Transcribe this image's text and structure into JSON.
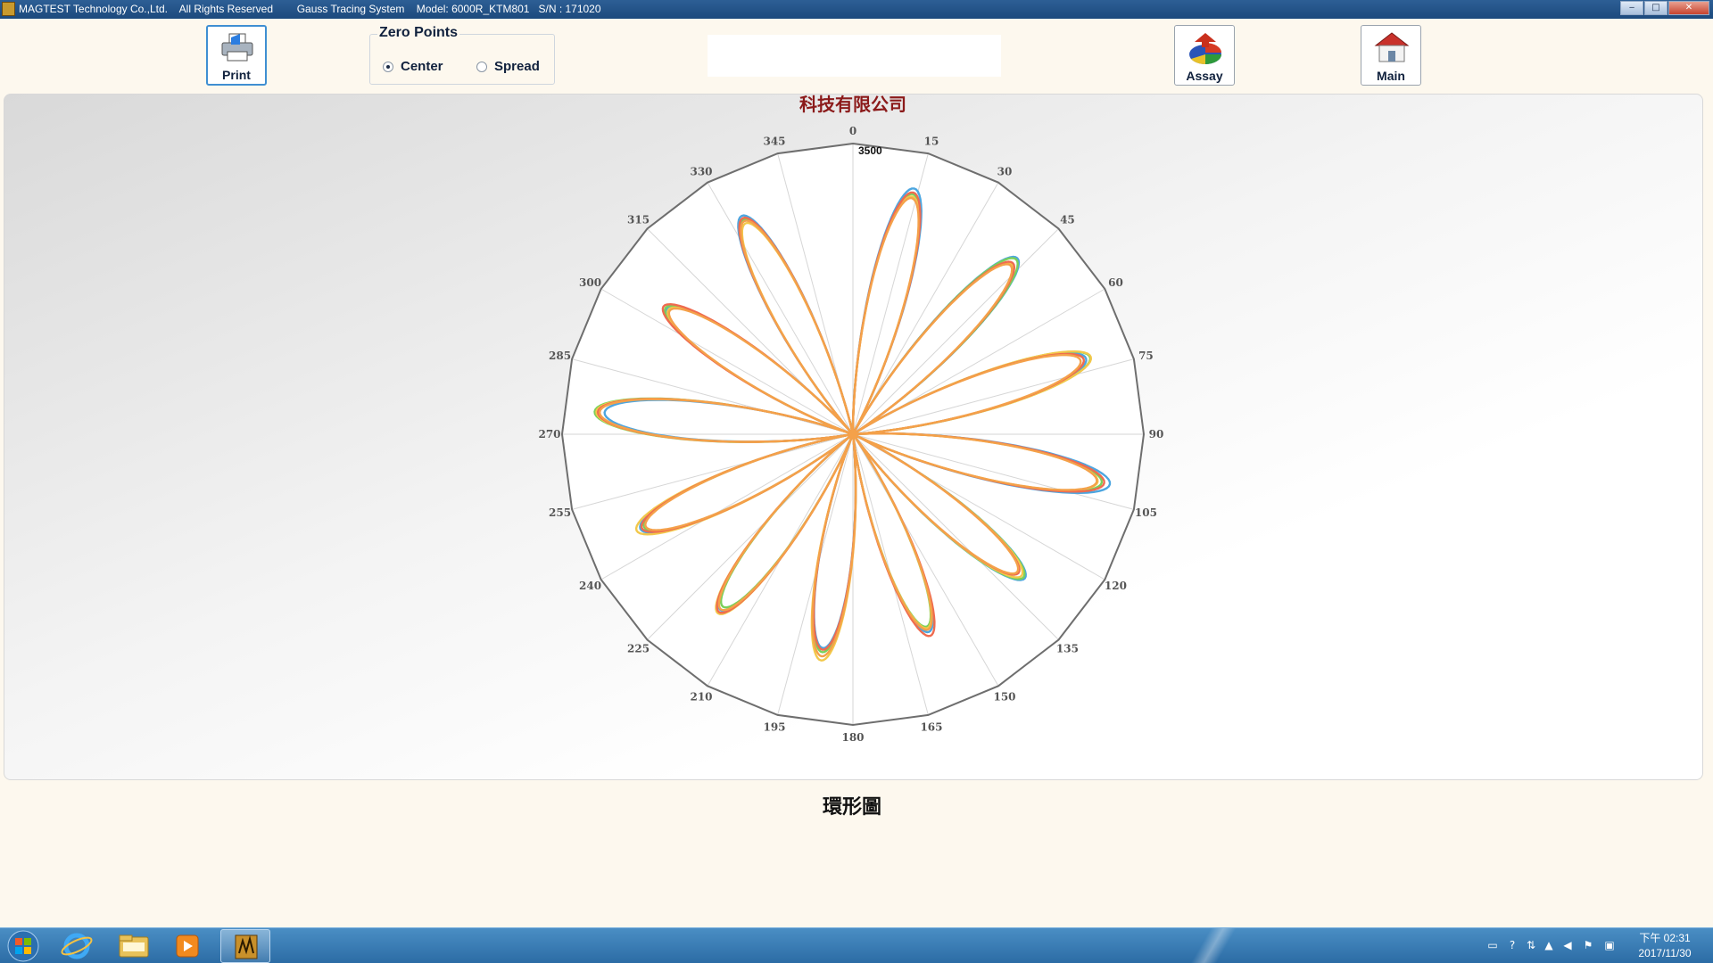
{
  "window": {
    "title": "MAGTEST Technology Co.,Ltd.    All Rights Reserved        Gauss Tracing System    Model: 6000R_KTM801   S/N : 171020",
    "minimize": "‒",
    "maximize": "□",
    "close": "✕"
  },
  "toolbar": {
    "print_label": "Print",
    "assay_label": "Assay",
    "main_label": "Main"
  },
  "zero_points": {
    "title": "Zero Points",
    "options": [
      "Center",
      "Spread"
    ],
    "selected": "Center"
  },
  "bottom_label": "環形圖",
  "colors": {
    "title": "#8b1a1a",
    "series": [
      "#4da6e0",
      "#7ad05a",
      "#f2c84b",
      "#ef6b4f",
      "#f4a14a"
    ]
  },
  "chart_data": {
    "type": "polar",
    "title": "科技有限公司",
    "angle_ticks": [
      0,
      15,
      30,
      45,
      60,
      75,
      90,
      105,
      120,
      135,
      150,
      165,
      180,
      195,
      210,
      225,
      240,
      255,
      270,
      285,
      300,
      315,
      330,
      345
    ],
    "radial_max_label": "3500",
    "rmax": 3500,
    "grid": true,
    "petal_count": 12,
    "petal_centers_deg": [
      14,
      43,
      72,
      101,
      130,
      159,
      188,
      217,
      246,
      275,
      304,
      333
    ],
    "series": [
      {
        "color": "#4da6e0",
        "peaks": [
          3050,
          2900,
          2950,
          3150,
          2700,
          2550,
          2600,
          2650,
          2800,
          3000,
          2700,
          2950
        ]
      },
      {
        "color": "#7ad05a",
        "peaks": [
          2980,
          2880,
          3000,
          3050,
          2680,
          2480,
          2650,
          2600,
          2750,
          3120,
          2720,
          2900
        ]
      },
      {
        "color": "#f2c84b",
        "peaks": [
          2950,
          2800,
          3010,
          3000,
          2650,
          2500,
          2750,
          2700,
          2850,
          3100,
          2680,
          2850
        ]
      },
      {
        "color": "#ef6b4f",
        "peaks": [
          3000,
          2820,
          2920,
          3080,
          2600,
          2600,
          2620,
          2680,
          2780,
          3080,
          2750,
          2920
        ]
      },
      {
        "color": "#f4a14a",
        "peaks": [
          2930,
          2780,
          2880,
          2990,
          2580,
          2520,
          2700,
          2640,
          2730,
          3060,
          2660,
          2880
        ]
      }
    ]
  },
  "taskbar": {
    "clock_time": "下午 02:31",
    "clock_date": "2017/11/30"
  }
}
